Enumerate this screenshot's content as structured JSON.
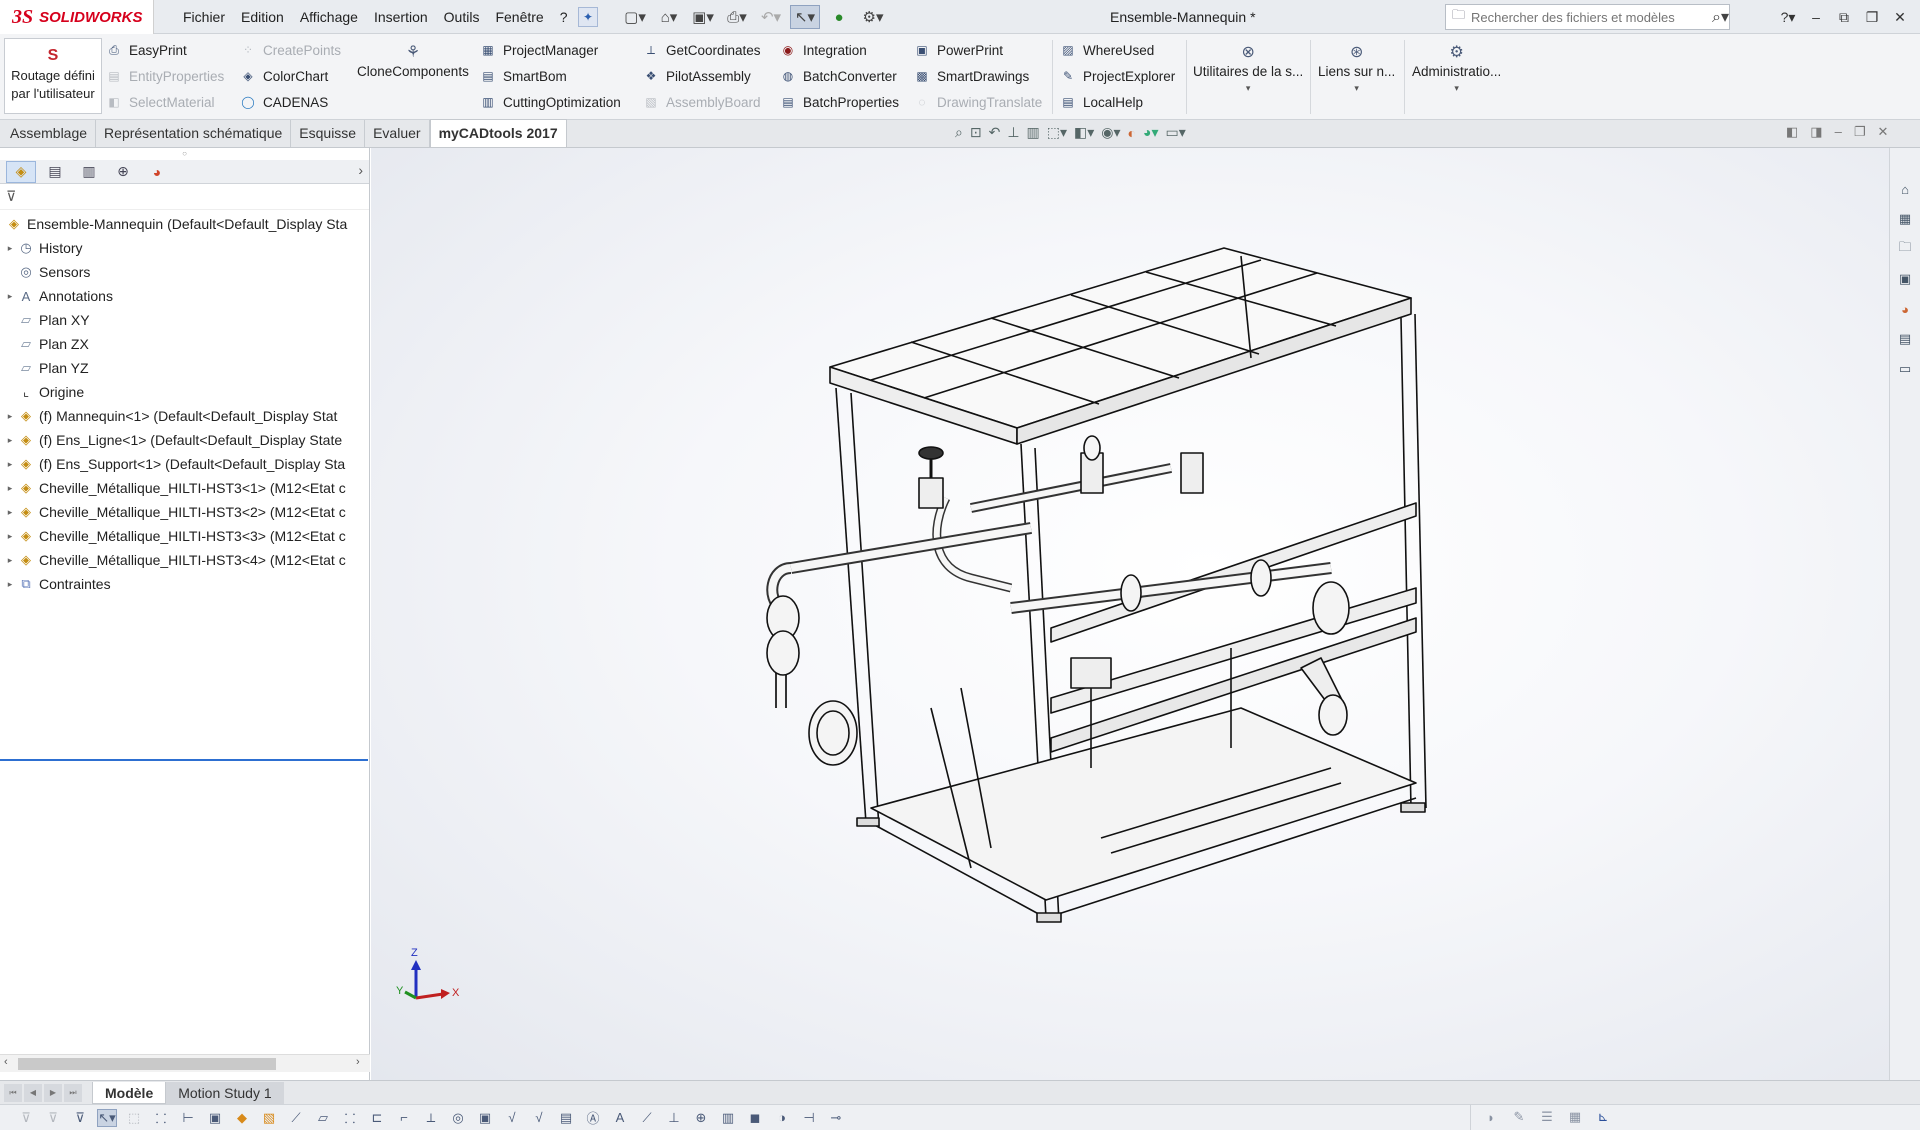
{
  "app": {
    "brand_ds": "3S",
    "brand": "SOLIDWORKS",
    "document_title": "Ensemble-Mannequin *"
  },
  "menu": [
    "Fichier",
    "Edition",
    "Affichage",
    "Insertion",
    "Outils",
    "Fenêtre",
    "?"
  ],
  "search": {
    "placeholder": "Rechercher des fichiers et modèles"
  },
  "ribbon": {
    "routage_label": "Routage défini par l'utilisateur",
    "col1": [
      {
        "label": "EasyPrint",
        "icon": "printer-icon",
        "disabled": false
      },
      {
        "label": "EntityProperties",
        "icon": "properties-icon",
        "disabled": true
      },
      {
        "label": "SelectMaterial",
        "icon": "material-icon",
        "disabled": true
      }
    ],
    "col2": [
      {
        "label": "CreatePoints",
        "icon": "points-icon",
        "disabled": true
      },
      {
        "label": "ColorChart",
        "icon": "color-icon",
        "disabled": false
      },
      {
        "label": "CADENAS",
        "icon": "cadenas-icon",
        "disabled": false
      }
    ],
    "clone": "CloneComponents",
    "col3": [
      {
        "label": "ProjectManager",
        "icon": "project-icon",
        "disabled": false
      },
      {
        "label": "SmartBom",
        "icon": "bom-icon",
        "disabled": false
      },
      {
        "label": "CuttingOptimization",
        "icon": "cutting-icon",
        "disabled": false
      }
    ],
    "col4": [
      {
        "label": "GetCoordinates",
        "icon": "coordinates-icon",
        "disabled": false
      },
      {
        "label": "PilotAssembly",
        "icon": "pilot-icon",
        "disabled": false
      },
      {
        "label": "AssemblyBoard",
        "icon": "board-icon",
        "disabled": true
      }
    ],
    "col5": [
      {
        "label": "Integration",
        "icon": "integration-icon",
        "disabled": false
      },
      {
        "label": "BatchConverter",
        "icon": "converter-icon",
        "disabled": false
      },
      {
        "label": "BatchProperties",
        "icon": "batch-icon",
        "disabled": false
      }
    ],
    "col6": [
      {
        "label": "PowerPrint",
        "icon": "powerprint-icon",
        "disabled": false
      },
      {
        "label": "SmartDrawings",
        "icon": "drawings-icon",
        "disabled": false
      },
      {
        "label": "DrawingTranslate",
        "icon": "translate-icon",
        "disabled": true
      }
    ],
    "col7": [
      {
        "label": "WhereUsed",
        "icon": "whereused-icon",
        "disabled": false
      },
      {
        "label": "ProjectExplorer",
        "icon": "explorer-icon",
        "disabled": false
      },
      {
        "label": "LocalHelp",
        "icon": "help-icon",
        "disabled": false
      }
    ],
    "utilitaires": "Utilitaires de la s...",
    "liens": "Liens sur n...",
    "admin": "Administratio..."
  },
  "tabs": [
    "Assemblage",
    "Représentation schématique",
    "Esquisse",
    "Evaluer",
    "myCADtools 2017"
  ],
  "active_tab": "myCADtools 2017",
  "tree": [
    {
      "label": "Ensemble-Mannequin  (Default<Default_Display Sta",
      "icon": "assembly-icon",
      "expandable": false,
      "indent": 0
    },
    {
      "label": "History",
      "icon": "history-icon",
      "expandable": true,
      "indent": 1
    },
    {
      "label": "Sensors",
      "icon": "sensor-icon",
      "expandable": false,
      "indent": 1
    },
    {
      "label": "Annotations",
      "icon": "annotation-icon",
      "expandable": true,
      "indent": 1
    },
    {
      "label": "Plan XY",
      "icon": "plane-icon",
      "expandable": false,
      "indent": 1
    },
    {
      "label": "Plan ZX",
      "icon": "plane-icon",
      "expandable": false,
      "indent": 1
    },
    {
      "label": "Plan YZ",
      "icon": "plane-icon",
      "expandable": false,
      "indent": 1
    },
    {
      "label": "Origine",
      "icon": "origin-icon",
      "expandable": false,
      "indent": 1
    },
    {
      "label": "(f) Mannequin<1> (Default<Default_Display Stat",
      "icon": "subassembly-icon",
      "expandable": true,
      "indent": 1
    },
    {
      "label": "(f) Ens_Ligne<1> (Default<Default_Display State",
      "icon": "subassembly-icon",
      "expandable": true,
      "indent": 1
    },
    {
      "label": "(f) Ens_Support<1> (Default<Default_Display Sta",
      "icon": "subassembly-icon",
      "expandable": true,
      "indent": 1
    },
    {
      "label": "Cheville_Métallique_HILTI-HST3<1> (M12<Etat c",
      "icon": "subassembly-icon",
      "expandable": true,
      "indent": 1
    },
    {
      "label": "Cheville_Métallique_HILTI-HST3<2> (M12<Etat c",
      "icon": "subassembly-icon",
      "expandable": true,
      "indent": 1
    },
    {
      "label": "Cheville_Métallique_HILTI-HST3<3> (M12<Etat c",
      "icon": "subassembly-icon",
      "expandable": true,
      "indent": 1
    },
    {
      "label": "Cheville_Métallique_HILTI-HST3<4> (M12<Etat c",
      "icon": "subassembly-icon",
      "expandable": true,
      "indent": 1
    },
    {
      "label": "Contraintes",
      "icon": "mates-icon",
      "expandable": true,
      "indent": 1
    }
  ],
  "bottom_tabs": [
    "Modèle",
    "Motion Study 1"
  ],
  "triad": {
    "z": "Z",
    "x": "X",
    "y": "Y"
  }
}
